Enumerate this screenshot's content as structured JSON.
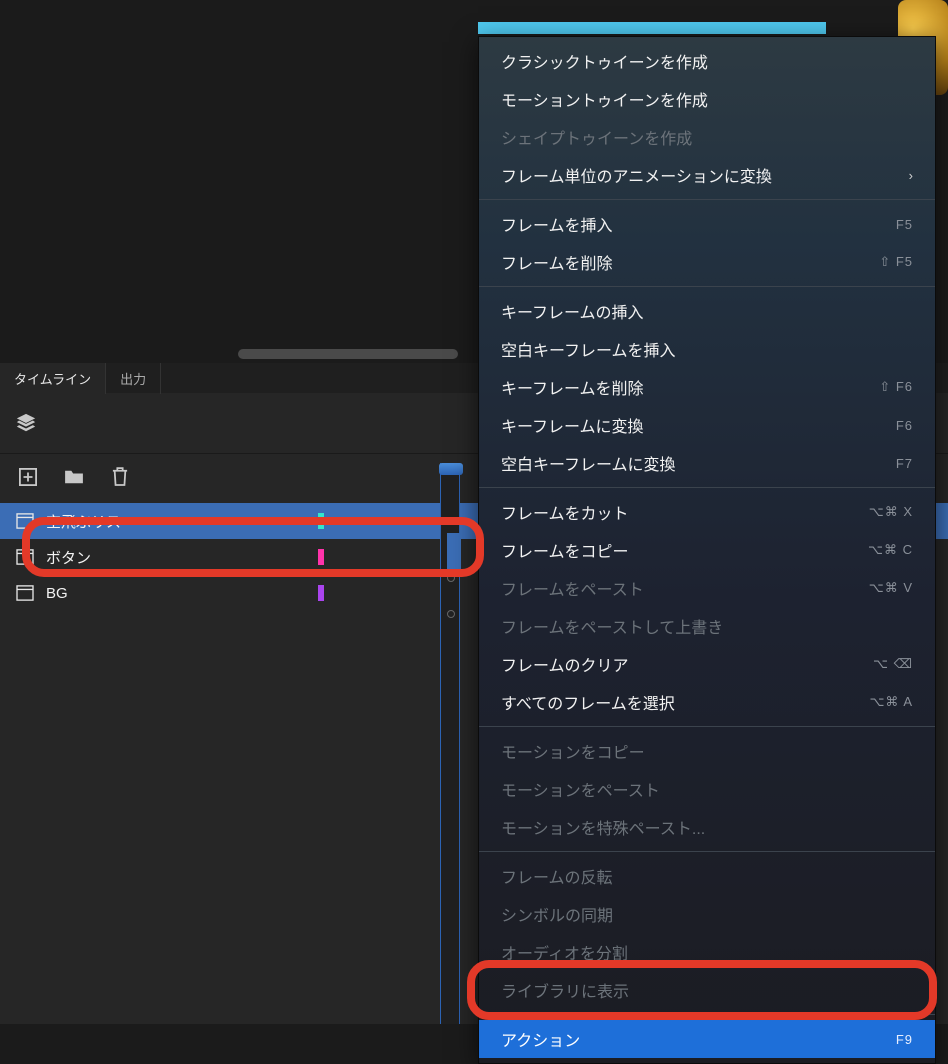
{
  "tabs": {
    "timeline": "タイムライン",
    "output": "出力"
  },
  "layers": [
    {
      "name": "空飛ぶリス",
      "color": "#33e6cc",
      "selected": true
    },
    {
      "name": "ボタン",
      "color": "#ff33aa",
      "selected": false
    },
    {
      "name": "BG",
      "color": "#aa44ee",
      "selected": false
    }
  ],
  "context_menu": {
    "groups": [
      [
        {
          "label": "クラシックトゥイーンを作成",
          "enabled": true
        },
        {
          "label": "モーショントゥイーンを作成",
          "enabled": true
        },
        {
          "label": "シェイプトゥイーンを作成",
          "enabled": false
        },
        {
          "label": "フレーム単位のアニメーションに変換",
          "enabled": true,
          "submenu": true
        }
      ],
      [
        {
          "label": "フレームを挿入",
          "enabled": true,
          "shortcut": "F5"
        },
        {
          "label": "フレームを削除",
          "enabled": true,
          "shortcut": "⇧ F5"
        }
      ],
      [
        {
          "label": "キーフレームの挿入",
          "enabled": true
        },
        {
          "label": "空白キーフレームを挿入",
          "enabled": true
        },
        {
          "label": "キーフレームを削除",
          "enabled": true,
          "shortcut": "⇧ F6"
        },
        {
          "label": "キーフレームに変換",
          "enabled": true,
          "shortcut": "F6"
        },
        {
          "label": "空白キーフレームに変換",
          "enabled": true,
          "shortcut": "F7"
        }
      ],
      [
        {
          "label": "フレームをカット",
          "enabled": true,
          "shortcut": "⌥⌘ X"
        },
        {
          "label": "フレームをコピー",
          "enabled": true,
          "shortcut": "⌥⌘ C"
        },
        {
          "label": "フレームをペースト",
          "enabled": false,
          "shortcut": "⌥⌘ V"
        },
        {
          "label": "フレームをペーストして上書き",
          "enabled": false
        },
        {
          "label": "フレームのクリア",
          "enabled": true,
          "shortcut": "⌥ ⌫"
        },
        {
          "label": "すべてのフレームを選択",
          "enabled": true,
          "shortcut": "⌥⌘ A"
        }
      ],
      [
        {
          "label": "モーションをコピー",
          "enabled": false
        },
        {
          "label": "モーションをペースト",
          "enabled": false
        },
        {
          "label": "モーションを特殊ペースト...",
          "enabled": false
        }
      ],
      [
        {
          "label": "フレームの反転",
          "enabled": false
        },
        {
          "label": "シンボルの同期",
          "enabled": false
        },
        {
          "label": "オーディオを分割",
          "enabled": false
        },
        {
          "label": "ライブラリに表示",
          "enabled": false
        }
      ],
      [
        {
          "label": "アクション",
          "enabled": true,
          "shortcut": "F9",
          "highlighted": true
        }
      ]
    ]
  }
}
